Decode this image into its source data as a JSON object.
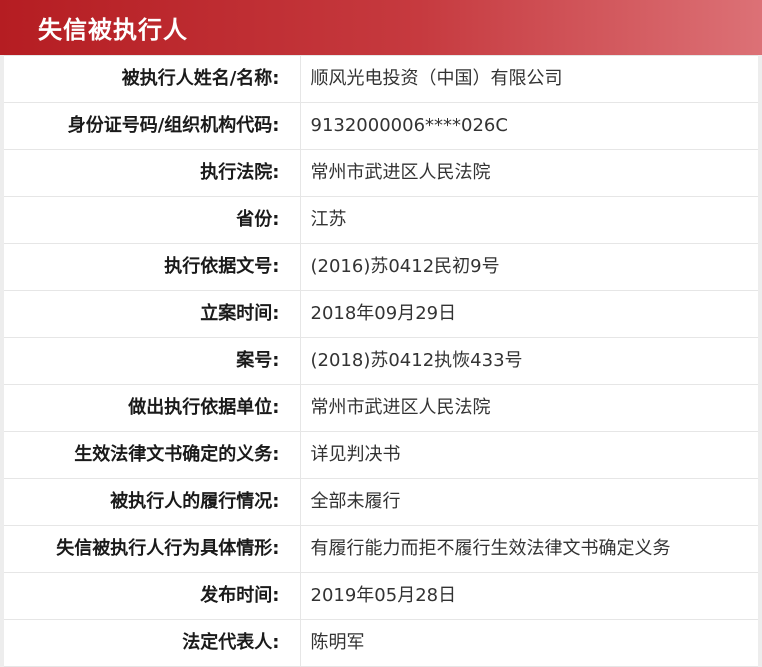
{
  "header": {
    "title": "失信被执行人"
  },
  "rows": [
    {
      "label": "被执行人姓名/名称:",
      "value": "顺风光电投资（中国）有限公司"
    },
    {
      "label": "身份证号码/组织机构代码:",
      "value": "9132000006****026C"
    },
    {
      "label": "执行法院:",
      "value": "常州市武进区人民法院"
    },
    {
      "label": "省份:",
      "value": "江苏"
    },
    {
      "label": "执行依据文号:",
      "value": "(2016)苏0412民初9号"
    },
    {
      "label": "立案时间:",
      "value": "2018年09月29日"
    },
    {
      "label": "案号:",
      "value": "(2018)苏0412执恢433号"
    },
    {
      "label": "做出执行依据单位:",
      "value": "常州市武进区人民法院"
    },
    {
      "label": "生效法律文书确定的义务:",
      "value": "详见判决书"
    },
    {
      "label": "被执行人的履行情况:",
      "value": "全部未履行"
    },
    {
      "label": "失信被执行人行为具体情形:",
      "value": "有履行能力而拒不履行生效法律文书确定义务"
    },
    {
      "label": "发布时间:",
      "value": "2019年05月28日"
    },
    {
      "label": "法定代表人:",
      "value": "陈明军"
    }
  ]
}
